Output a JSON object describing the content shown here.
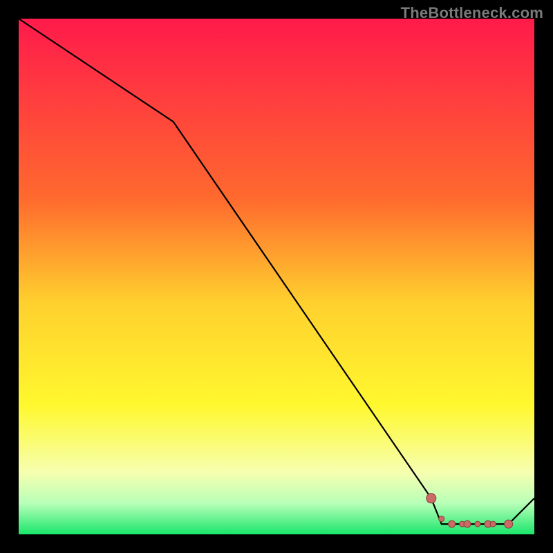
{
  "watermark": "TheBottleneck.com",
  "chart_data": {
    "type": "line",
    "title": "",
    "xlabel": "",
    "ylabel": "",
    "xlim": [
      0,
      100
    ],
    "ylim": [
      0,
      100
    ],
    "grid": false,
    "series": [
      {
        "name": "bottleneck-curve",
        "x": [
          0,
          30,
          80,
          82,
          95,
          100
        ],
        "y": [
          100,
          80,
          7,
          2,
          2,
          7
        ]
      }
    ],
    "markers": {
      "name": "selected-range",
      "x": [
        80,
        82,
        84,
        86,
        87,
        89,
        91,
        92,
        95
      ],
      "y": [
        7,
        3,
        2,
        2,
        2,
        2,
        2,
        2,
        2
      ]
    },
    "background_gradient": {
      "stops": [
        {
          "offset": 0.0,
          "color": "#ff1a4b"
        },
        {
          "offset": 0.35,
          "color": "#ff6a2e"
        },
        {
          "offset": 0.55,
          "color": "#ffd02e"
        },
        {
          "offset": 0.75,
          "color": "#fff82e"
        },
        {
          "offset": 0.88,
          "color": "#f6ffb0"
        },
        {
          "offset": 0.94,
          "color": "#b8ffb8"
        },
        {
          "offset": 1.0,
          "color": "#19e66b"
        }
      ]
    },
    "marker_style": {
      "fill": "#cc6a66",
      "stroke": "#8a3c3a",
      "radius_min": 4,
      "radius_max": 7
    }
  }
}
